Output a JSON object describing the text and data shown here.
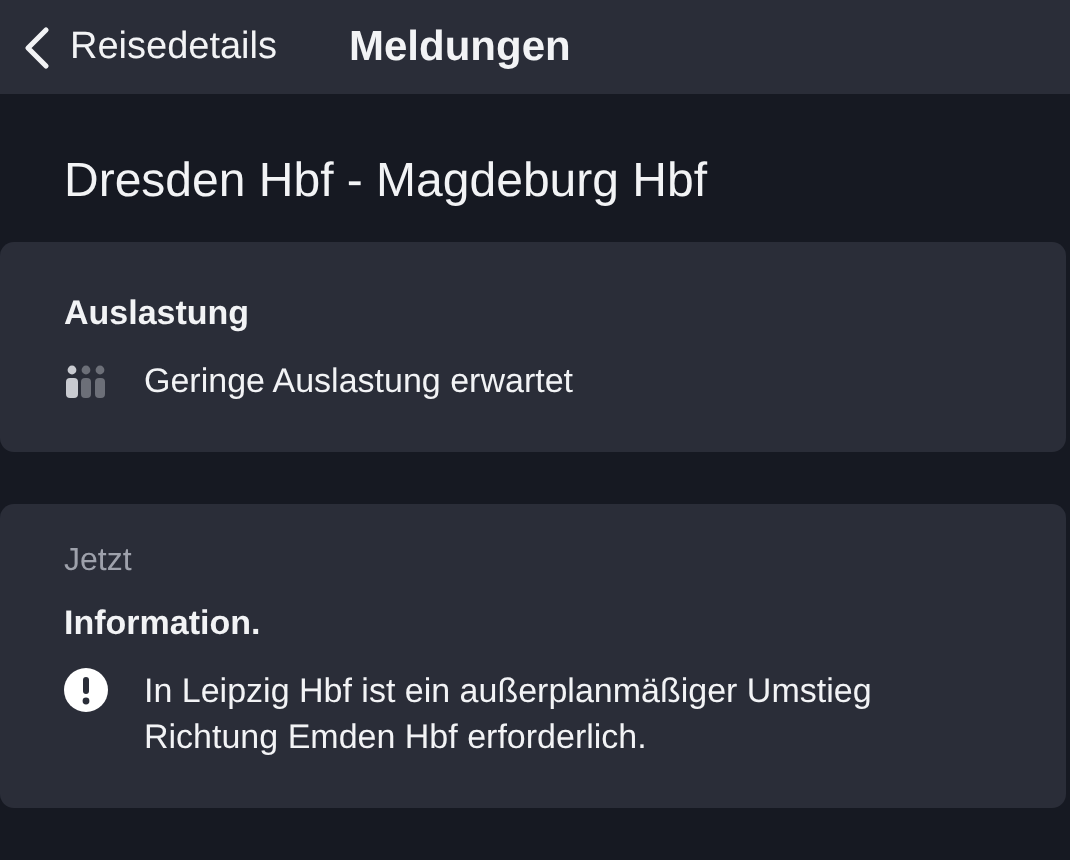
{
  "header": {
    "back_label": "Reisedetails",
    "title": "Meldungen"
  },
  "route": "Dresden Hbf - Magdeburg Hbf",
  "cards": [
    {
      "kind": "occupancy",
      "heading": "Auslastung",
      "text": "Geringe Auslastung erwartet"
    },
    {
      "kind": "message",
      "time": "Jetzt",
      "heading": "Information.",
      "text": "In Leipzig Hbf ist ein außerplanmäßiger Umstieg Richtung Emden Hbf erforderlich."
    }
  ]
}
